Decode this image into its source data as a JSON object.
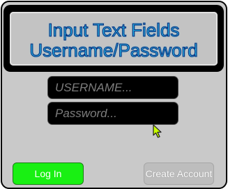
{
  "header": {
    "title_line1": "Input Text Fields",
    "title_line2": "Username/Password"
  },
  "form": {
    "username": {
      "value": "",
      "placeholder": "USERNAME..."
    },
    "password": {
      "value": "",
      "placeholder": "Password..."
    }
  },
  "buttons": {
    "login_label": "Log In",
    "create_account_label": "Create Account"
  },
  "icons": {
    "cursor": "mouse-pointer-icon"
  },
  "colors": {
    "title_fill": "#24b7e6",
    "title_outline": "#0c2a7a",
    "login_button": "#19f013",
    "create_account_button": "#bdbdbd",
    "cursor": "#c8ff00"
  }
}
